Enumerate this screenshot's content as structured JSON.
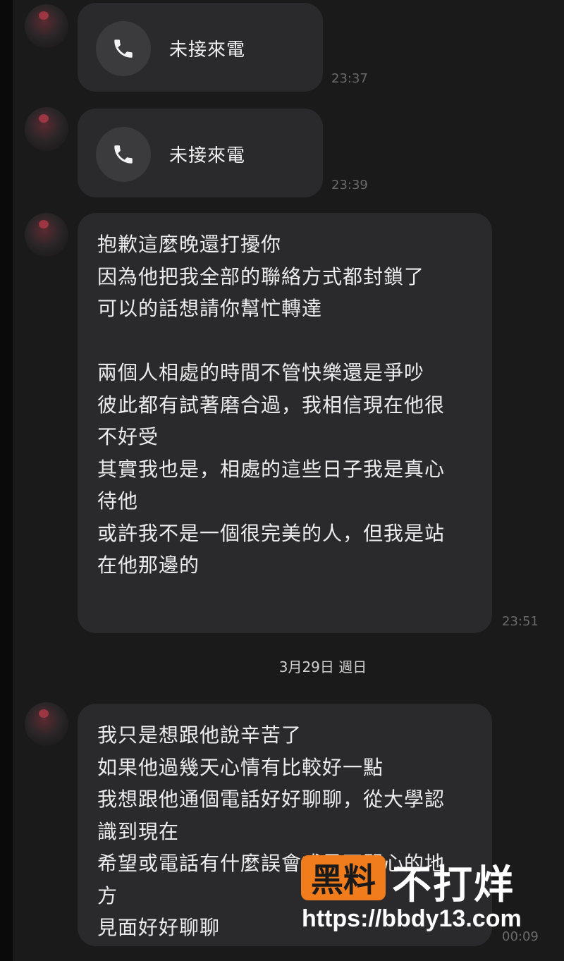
{
  "messages": [
    {
      "type": "call",
      "label": "未接來電",
      "time": "23:37"
    },
    {
      "type": "call",
      "label": "未接來電",
      "time": "23:39"
    },
    {
      "type": "text",
      "lines": [
        "抱歉這麼晚還打擾你",
        "因為他把我全部的聯絡方式都封鎖了",
        "可以的話想請你幫忙轉達",
        "",
        "兩個人相處的時間不管快樂還是爭吵",
        "彼此都有試著磨合過，我相信現在他很",
        "不好受",
        "其實我也是，相處的這些日子我是真心",
        "待他",
        "或許我不是一個很完美的人，但我是站",
        "在他那邊的"
      ],
      "time": "23:51"
    },
    {
      "type": "text",
      "lines": [
        "我只是想跟他說辛苦了",
        "如果他過幾天心情有比較好一點",
        "我想跟他通個電話好好聊聊，從大學認",
        "識到現在",
        "希望或電話有什麼誤會或是不開心的地",
        "方",
        "見面好好聊聊"
      ],
      "time": "00:09"
    }
  ],
  "date_separator": "3月29日 週日",
  "watermark": {
    "brand": "黑料",
    "slogan": "不打烊",
    "url": "https://bbdy13.com",
    "brand_color": "#f07c1c"
  },
  "icons": {
    "call": "phone-icon",
    "avatar": "avatar"
  }
}
